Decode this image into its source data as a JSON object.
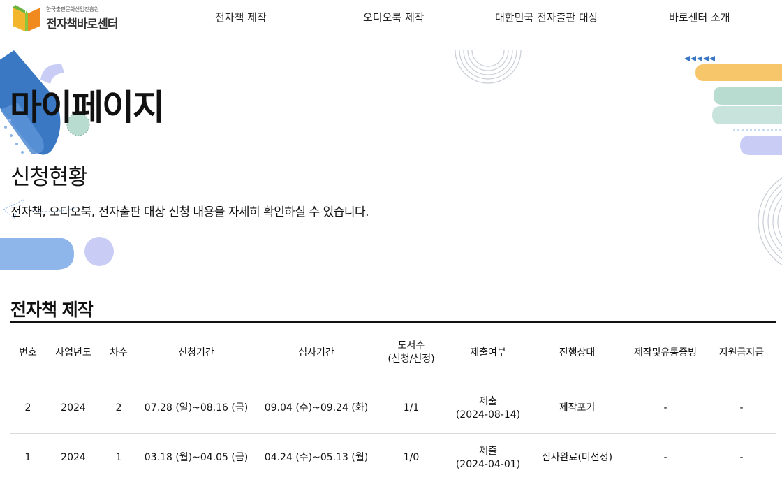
{
  "header": {
    "logo_sub": "한국출판문화산업진흥원",
    "logo_main": "전자책바로센터",
    "nav": [
      "전자책 제작",
      "오디오북 제작",
      "대한민국 전자출판 대상",
      "바로센터 소개"
    ]
  },
  "hero": {
    "title": "마이페이지"
  },
  "section": {
    "title": "신청현황",
    "description": "전자책, 오디오북, 전자출판 대상 신청 내용을 자세히 확인하실 수 있습니다."
  },
  "ebook_table": {
    "title": "전자책 제작",
    "columns": [
      "번호",
      "사업년도",
      "차수",
      "신청기간",
      "심사기간",
      "도서수\n(신청/선정)",
      "제출여부",
      "진행상태",
      "제작및유통증빙",
      "지원금지급"
    ],
    "rows": [
      [
        "2",
        "2024",
        "2",
        "07.28 (일)~08.16 (금)",
        "09.04 (수)~09.24 (화)",
        "1/1",
        "제출\n(2024-08-14)",
        "제작포기",
        "-",
        "-"
      ],
      [
        "1",
        "2024",
        "1",
        "03.18 (월)~04.05 (금)",
        "04.24 (수)~05.13 (월)",
        "1/0",
        "제출\n(2024-04-01)",
        "심사완료(미선정)",
        "-",
        "-"
      ]
    ]
  },
  "colors": {
    "blue": "#3a78c4",
    "light_blue": "#8fb6ea",
    "lavender": "#c9cdf5",
    "mint": "#b8dcd0",
    "yellow": "#f8c66a"
  }
}
